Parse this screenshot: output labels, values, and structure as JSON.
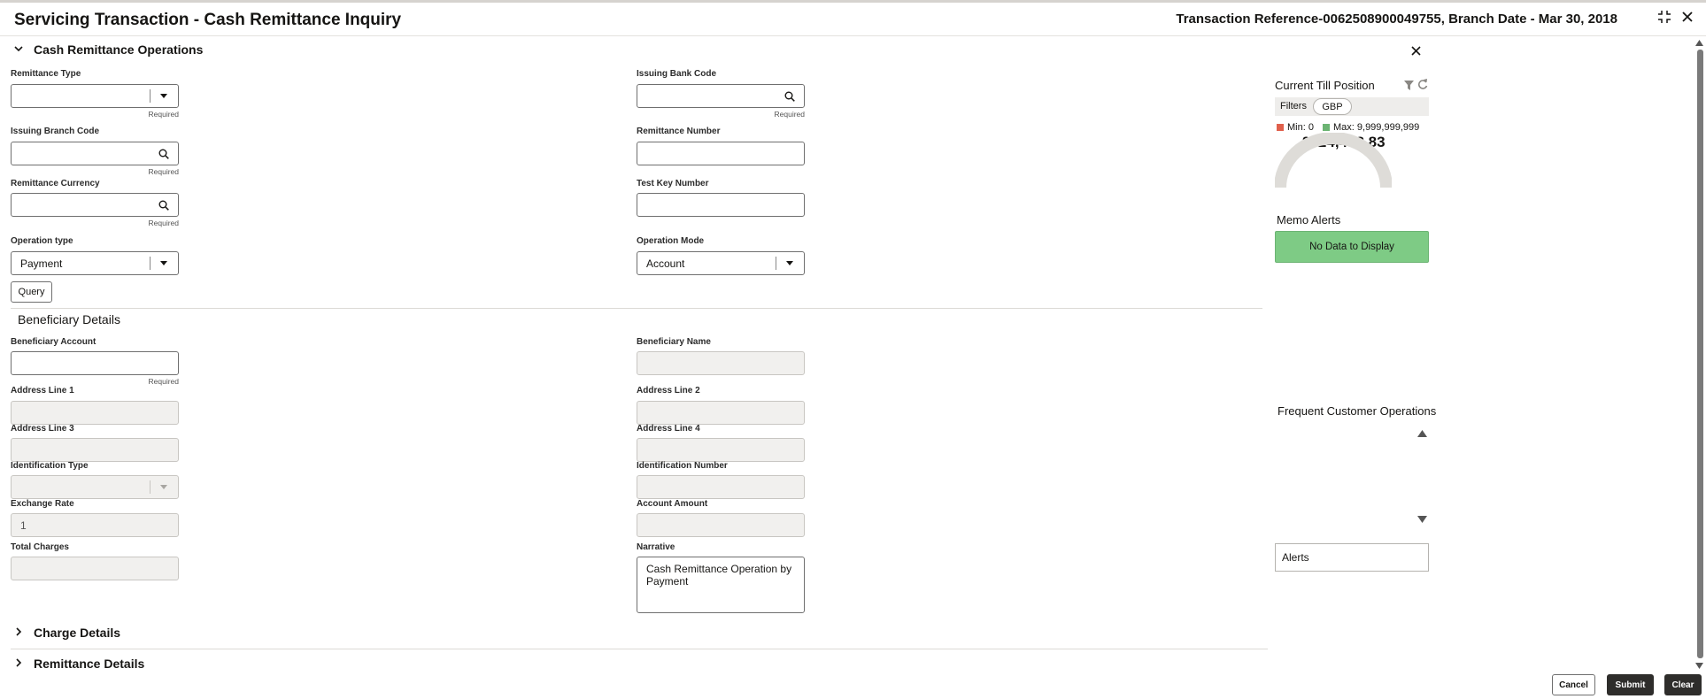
{
  "header": {
    "title": "Servicing Transaction - Cash Remittance Inquiry",
    "reference": "Transaction Reference-0062508900049755, Branch Date - Mar 30, 2018"
  },
  "sections": {
    "cash_remittance_operations": "Cash Remittance Operations",
    "beneficiary_details": "Beneficiary Details",
    "charge_details": "Charge Details",
    "remittance_details": "Remittance Details"
  },
  "required_text": "Required",
  "fields": {
    "remittance_type": {
      "label": "Remittance Type",
      "value": ""
    },
    "issuing_bank_code": {
      "label": "Issuing Bank Code",
      "value": ""
    },
    "issuing_branch_code": {
      "label": "Issuing Branch Code",
      "value": ""
    },
    "remittance_number": {
      "label": "Remittance Number",
      "value": ""
    },
    "remittance_currency": {
      "label": "Remittance Currency",
      "value": ""
    },
    "test_key_number": {
      "label": "Test Key Number",
      "value": ""
    },
    "operation_type": {
      "label": "Operation type",
      "value": "Payment"
    },
    "operation_mode": {
      "label": "Operation Mode",
      "value": "Account"
    },
    "beneficiary_account": {
      "label": "Beneficiary Account",
      "value": ""
    },
    "beneficiary_name": {
      "label": "Beneficiary Name",
      "value": ""
    },
    "address_line_1": {
      "label": "Address Line 1",
      "value": ""
    },
    "address_line_2": {
      "label": "Address Line 2",
      "value": ""
    },
    "address_line_3": {
      "label": "Address Line 3",
      "value": ""
    },
    "address_line_4": {
      "label": "Address Line 4",
      "value": ""
    },
    "identification_type": {
      "label": "Identification Type",
      "value": ""
    },
    "identification_number": {
      "label": "Identification Number",
      "value": ""
    },
    "exchange_rate": {
      "label": "Exchange Rate",
      "value": "1"
    },
    "account_amount": {
      "label": "Account Amount",
      "value": ""
    },
    "total_charges": {
      "label": "Total Charges",
      "value": ""
    },
    "narrative": {
      "label": "Narrative",
      "value": "Cash Remittance Operation by Payment"
    }
  },
  "buttons": {
    "query": "Query",
    "cancel": "Cancel",
    "submit": "Submit",
    "clear": "Clear"
  },
  "side_panel": {
    "till": {
      "title": "Current Till Position",
      "filters_label": "Filters",
      "currency_chip": "GBP",
      "min_label": "Min: 0",
      "max_label": "Max: 9,999,999,999",
      "amount": "£424,448.83",
      "min_color": "#e0604c",
      "max_color": "#6cb473",
      "gauge_fraction": 0.0
    },
    "memo": {
      "title": "Memo Alerts",
      "empty_text": "No Data to Display",
      "color": "#7ecb85"
    },
    "frequent": {
      "title": "Frequent Customer Operations"
    },
    "alerts_label": "Alerts"
  }
}
